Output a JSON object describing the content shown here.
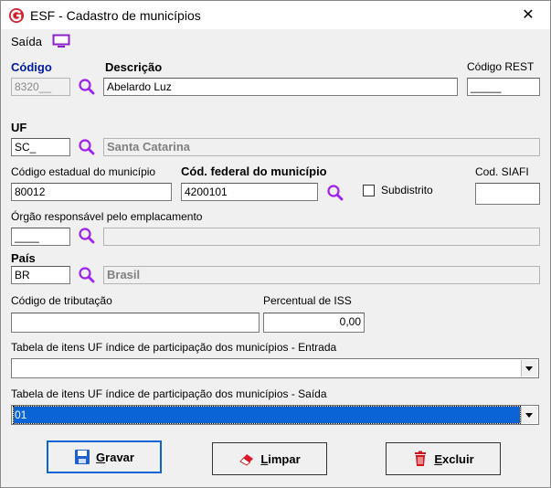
{
  "window": {
    "title": "ESF - Cadastro de municípios",
    "close_glyph": "✕"
  },
  "menu": {
    "saida_label": "Saída"
  },
  "codigo": {
    "label": "Código",
    "value": "8320__"
  },
  "descricao": {
    "label": "Descrição",
    "value": "Abelardo Luz"
  },
  "codigo_rest": {
    "label": "Código REST",
    "value": "_____"
  },
  "uf": {
    "label": "UF",
    "value": "SC_",
    "description": "Santa Catarina"
  },
  "codigo_estadual": {
    "label": "Código estadual do município",
    "value": "80012"
  },
  "codigo_federal": {
    "label": "Cód. federal do município",
    "value": "4200101"
  },
  "subdistrito": {
    "label": "Subdistrito",
    "checked": false
  },
  "cod_siafi": {
    "label": "Cod. SIAFI",
    "value": ""
  },
  "orgao": {
    "label": "Órgão responsável pelo emplacamento",
    "value": "____",
    "description": ""
  },
  "pais": {
    "label": "País",
    "value": "BR",
    "description": "Brasil"
  },
  "codigo_tributacao": {
    "label": "Código de tributação",
    "value": ""
  },
  "percentual_iss": {
    "label": "Percentual de ISS",
    "value": "0,00"
  },
  "tabela_entrada": {
    "label": "Tabela de itens UF índice de participação dos municípios - Entrada",
    "value": ""
  },
  "tabela_saida": {
    "label": "Tabela de itens UF índice de participação dos municípios - Saída",
    "value": "01"
  },
  "buttons": {
    "gravar_first": "G",
    "gravar_rest": "ravar",
    "limpar_first": "L",
    "limpar_rest": "impar",
    "excluir_first": "E",
    "excluir_rest": "xcluir"
  },
  "colors": {
    "accent": "#0a64d6",
    "label_blue": "#001b9c",
    "lookup_purple": "#a020f0",
    "brand_red": "#d0202a"
  },
  "icons": [
    "app-logo-icon",
    "close-icon",
    "monitor-icon",
    "search-icon",
    "floppy-icon",
    "eraser-icon",
    "trash-icon"
  ]
}
